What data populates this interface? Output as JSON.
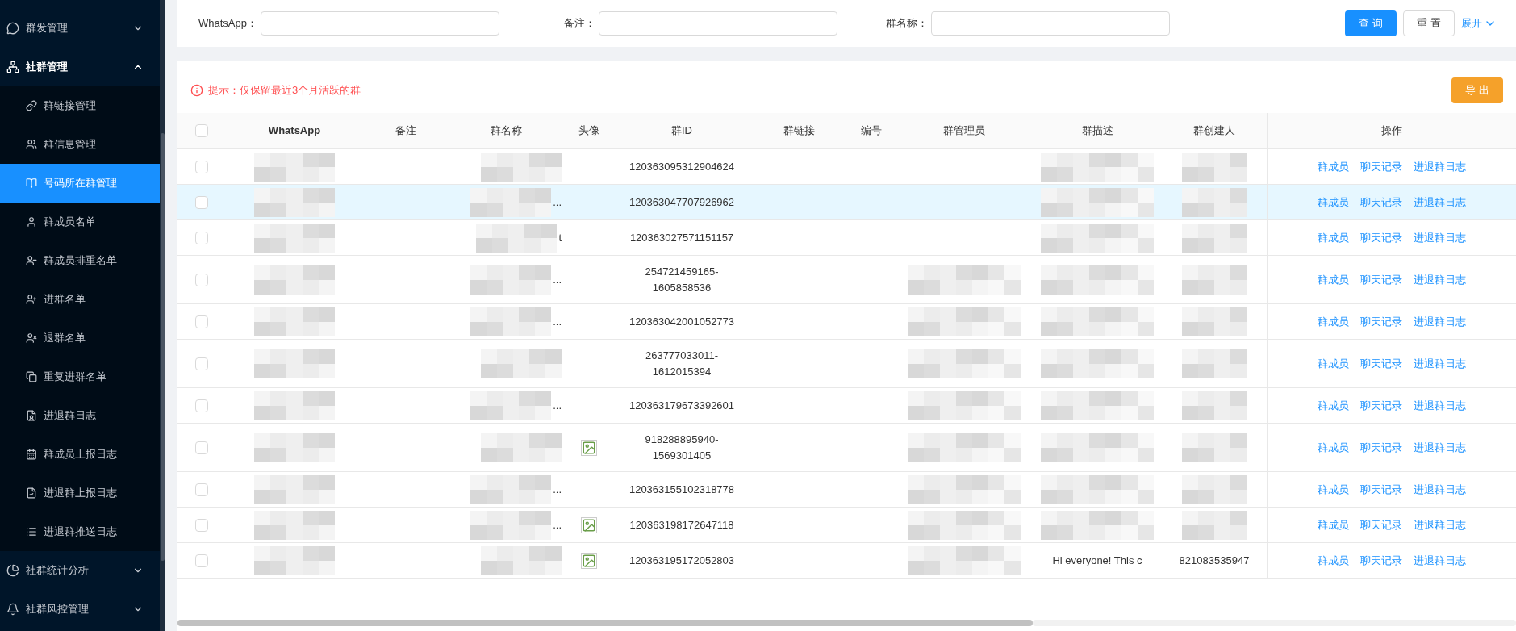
{
  "sidebar": {
    "items": [
      {
        "label": "群发管理",
        "expanded": false
      },
      {
        "label": "社群管理",
        "expanded": true,
        "children": [
          {
            "label": "群链接管理",
            "selected": false
          },
          {
            "label": "群信息管理",
            "selected": false
          },
          {
            "label": "号码所在群管理",
            "selected": true
          },
          {
            "label": "群成员名单",
            "selected": false
          },
          {
            "label": "群成员排重名单",
            "selected": false
          },
          {
            "label": "进群名单",
            "selected": false
          },
          {
            "label": "退群名单",
            "selected": false
          },
          {
            "label": "重复进群名单",
            "selected": false
          },
          {
            "label": "进退群日志",
            "selected": false
          },
          {
            "label": "群成员上报日志",
            "selected": false
          },
          {
            "label": "进退群上报日志",
            "selected": false
          },
          {
            "label": "进退群推送日志",
            "selected": false
          }
        ]
      },
      {
        "label": "社群统计分析",
        "expanded": false
      },
      {
        "label": "社群风控管理",
        "expanded": false
      }
    ]
  },
  "filters": [
    {
      "label": "WhatsApp："
    },
    {
      "label": "备注："
    },
    {
      "label": "群名称："
    }
  ],
  "search_button": "查 询",
  "reset_button": "重 置",
  "expand_link": "展开",
  "hint": "提示：仅保留最近3个月活跃的群",
  "export_button": "导 出",
  "table": {
    "all_checked": false,
    "columns": [
      "WhatsApp",
      "备注",
      "群名称",
      "头像",
      "群ID",
      "群链接",
      "编号",
      "群管理员",
      "群描述",
      "群创建人",
      "操作"
    ],
    "rows": [
      {
        "checked": false,
        "highlighted": false,
        "name_tail": "",
        "avatar": false,
        "id": "120363095312904624",
        "actions": [
          "群成员",
          "聊天记录",
          "进退群日志"
        ]
      },
      {
        "checked": false,
        "highlighted": true,
        "name_tail": "...",
        "avatar": false,
        "id": "120363047707926962",
        "actions": [
          "群成员",
          "聊天记录",
          "进退群日志"
        ]
      },
      {
        "checked": false,
        "highlighted": false,
        "name_tail": "t",
        "avatar": false,
        "id": "120363027571151157",
        "actions": [
          "群成员",
          "聊天记录",
          "进退群日志"
        ]
      },
      {
        "checked": false,
        "highlighted": false,
        "name_tail": "...",
        "avatar": false,
        "id": "254721459165-1605858536",
        "actions": [
          "群成员",
          "聊天记录",
          "进退群日志"
        ]
      },
      {
        "checked": false,
        "highlighted": false,
        "name_tail": "...",
        "avatar": false,
        "id": "120363042001052773",
        "actions": [
          "群成员",
          "聊天记录",
          "进退群日志"
        ]
      },
      {
        "checked": false,
        "highlighted": false,
        "avatar": false,
        "id": "263777033011-1612015394",
        "actions": [
          "群成员",
          "聊天记录",
          "进退群日志"
        ]
      },
      {
        "checked": false,
        "highlighted": false,
        "name_tail": "...",
        "avatar": false,
        "id": "120363179673392601",
        "actions": [
          "群成员",
          "聊天记录",
          "进退群日志"
        ]
      },
      {
        "checked": false,
        "highlighted": false,
        "avatar": true,
        "id": "918288895940-1569301405",
        "actions": [
          "群成员",
          "聊天记录",
          "进退群日志"
        ]
      },
      {
        "checked": false,
        "highlighted": false,
        "name_tail": "...",
        "avatar": false,
        "id": "120363155102318778",
        "actions": [
          "群成员",
          "聊天记录",
          "进退群日志"
        ]
      },
      {
        "checked": false,
        "highlighted": false,
        "name_tail": "...",
        "avatar": true,
        "id": "120363198172647118",
        "actions": [
          "群成员",
          "聊天记录",
          "进退群日志"
        ]
      },
      {
        "checked": false,
        "highlighted": false,
        "avatar": true,
        "id": "120363195172052803",
        "description": "Hi everyone! This c",
        "creator": "821083535947",
        "actions": [
          "群成员",
          "聊天记录",
          "进退群日志"
        ]
      }
    ]
  }
}
